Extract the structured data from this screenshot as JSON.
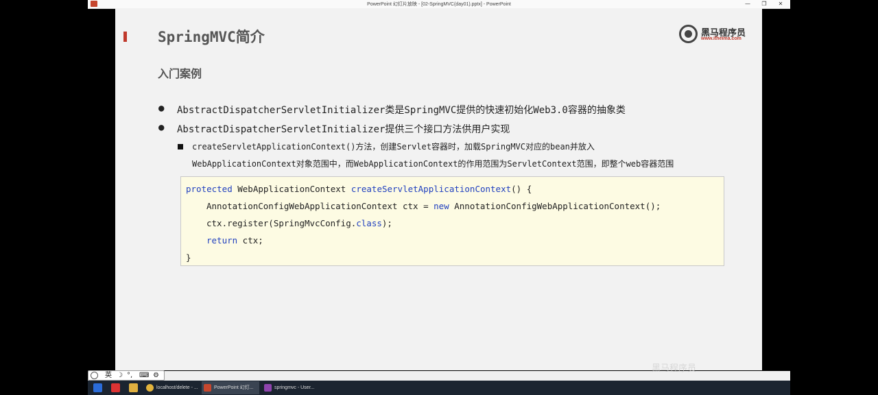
{
  "window": {
    "title": "PowerPoint 幻灯片放映 - [02-SpringMVC(day01).pptx] - PowerPoint",
    "minimize": "—",
    "maximize": "❐",
    "close": "✕"
  },
  "slide": {
    "title": "SpringMVC简介",
    "logo": {
      "name": "黑马程序员",
      "url": "www.itheima.com"
    },
    "subtitle": "入门案例",
    "bullets": [
      "AbstractDispatcherServletInitializer类是SpringMVC提供的快速初始化Web3.0容器的抽象类",
      "AbstractDispatcherServletInitializer提供三个接口方法供用户实现"
    ],
    "sub_bullet": {
      "line1": "createServletApplicationContext()方法，创建Servlet容器时，加载SpringMVC对应的bean并放入",
      "line2": "WebApplicationContext对象范围中，而WebApplicationContext的作用范围为ServletContext范围，即整个web容器范围"
    },
    "code": {
      "l1_kw": "protected",
      "l1_type": " WebApplicationContext ",
      "l1_fn": "createServletApplicationContext",
      "l1_rest": "() {",
      "l2_a": "AnnotationConfigWebApplicationContext ctx = ",
      "l2_kw": "new",
      "l2_b": " AnnotationConfigWebApplicationContext();",
      "l3_a": "ctx.register(SpringMvcConfig.",
      "l3_kw": "class",
      "l3_b": ");",
      "l4_kw": "return",
      "l4_b": " ctx;",
      "l5": "}"
    }
  },
  "ime": {
    "lang": "英",
    "moon": "☽",
    "punct": "°,",
    "keyboard": "⌨",
    "settings": "⚙"
  },
  "taskbar": {
    "items": [
      {
        "label": "localhost/delete - ..."
      },
      {
        "label": "PowerPoint 幻灯..."
      },
      {
        "label": "springmvc - User..."
      }
    ]
  },
  "overlay": "黑马程序员",
  "colors": {
    "accent": "#c0392b",
    "keyword": "#1f3fbf",
    "code_bg": "#fdfbe3"
  }
}
